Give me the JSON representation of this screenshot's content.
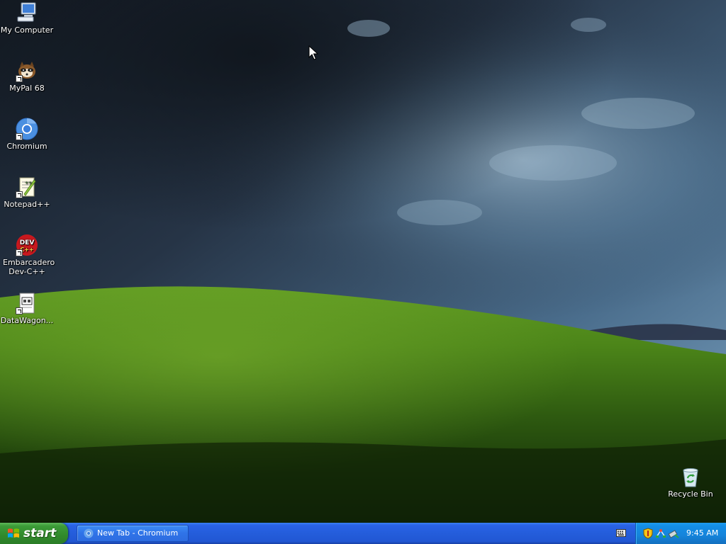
{
  "desktop": {
    "icons": [
      {
        "label": "My Computer",
        "icon": "my-computer-icon",
        "shortcut": false
      },
      {
        "label": "MyPal 68",
        "icon": "mypal-icon",
        "shortcut": true
      },
      {
        "label": "Chromium",
        "icon": "chromium-icon",
        "shortcut": true
      },
      {
        "label": "Notepad++",
        "icon": "notepad-plus-plus-icon",
        "shortcut": true
      },
      {
        "label": "Embarcadero Dev-C++",
        "icon": "dev-cpp-icon",
        "shortcut": true,
        "logo_text": "DEV C++"
      },
      {
        "label": "DataWagon...",
        "icon": "datawagon-icon",
        "shortcut": true
      },
      {
        "label": "Recycle Bin",
        "icon": "recycle-bin-icon",
        "shortcut": false
      }
    ]
  },
  "taskbar": {
    "start_label": "start",
    "tasks": [
      {
        "label": "New Tab - Chromium",
        "icon": "chromium-icon",
        "active": false
      }
    ],
    "tray": {
      "icons": [
        "keyboard-icon",
        "security-shield-icon",
        "network-icon",
        "safely-remove-hardware-icon"
      ],
      "clock": "9:45 AM"
    }
  },
  "colors": {
    "taskbar_blue": "#245ddb",
    "start_green": "#318a2c",
    "tray_blue": "#1584db",
    "hill_green": "#4f8a1a",
    "sky_dark": "#1f2a38"
  }
}
